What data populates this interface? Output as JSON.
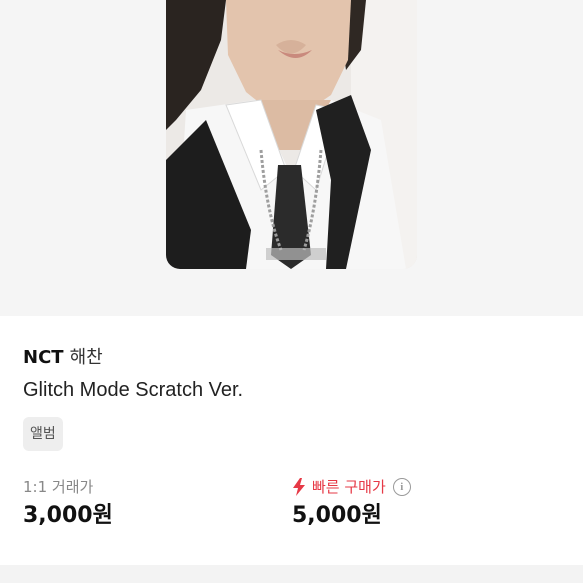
{
  "product": {
    "group": "NCT",
    "member": "해찬",
    "title": "Glitch Mode Scratch Ver.",
    "badge": "앨범"
  },
  "prices": {
    "trade_label": "1:1 거래가",
    "trade_value": "3,000원",
    "quick_label": "빠른 구매가",
    "quick_value": "5,000원"
  },
  "icons": {
    "quick_buy": "lightning-icon",
    "info": "info-icon"
  },
  "colors": {
    "accent_red": "#e63946",
    "badge_bg": "#eeeeee",
    "hero_bg": "#f5f5f5"
  }
}
